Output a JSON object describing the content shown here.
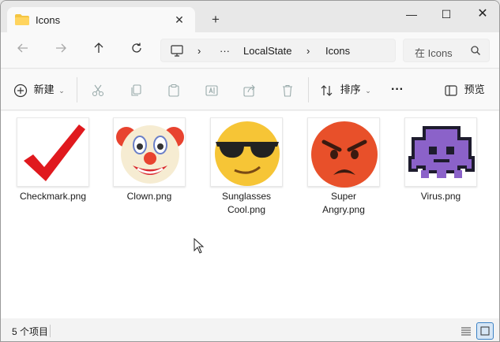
{
  "window": {
    "tab_title": "Icons",
    "tab_close": "✕",
    "new_tab": "+",
    "minimize": "—",
    "maximize": "☐",
    "close": "✕"
  },
  "address": {
    "breadcrumb": [
      "LocalState",
      "Icons"
    ],
    "ellipsis": "···",
    "separator": "›",
    "search_placeholder": "在 Icons"
  },
  "toolbar": {
    "new_label": "新建",
    "sort_label": "排序",
    "more_label": "···",
    "preview_label": "预览"
  },
  "files": [
    {
      "name": "Checkmark.png",
      "icon": "checkmark-icon"
    },
    {
      "name": "Clown.png",
      "icon": "clown-icon"
    },
    {
      "name": "Sunglasses\nCool.png",
      "icon": "sunglasses-icon"
    },
    {
      "name": "Super\nAngry.png",
      "icon": "angry-icon"
    },
    {
      "name": "Virus.png",
      "icon": "virus-icon"
    }
  ],
  "status": {
    "count_text": "5 个项目"
  },
  "colors": {
    "accent": "#0067c0",
    "folder": "#f4c542",
    "checkmark": "#e0191e"
  }
}
